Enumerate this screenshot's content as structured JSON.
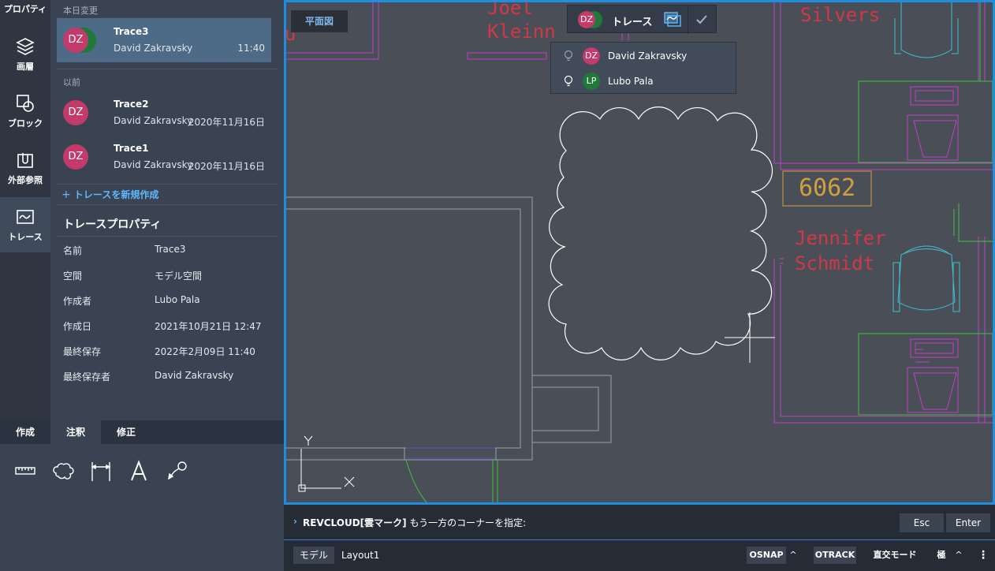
{
  "rail": {
    "title": "プロパティ",
    "items": [
      {
        "label": "画層",
        "icon": "layers-icon"
      },
      {
        "label": "ブロック",
        "icon": "block-icon"
      },
      {
        "label": "外部参照",
        "icon": "xref-icon"
      },
      {
        "label": "トレース",
        "icon": "trace-icon"
      }
    ]
  },
  "traces": {
    "today_header": "本日変更",
    "earlier_header": "以前",
    "items": [
      {
        "name": "Trace3",
        "author": "David Zakravsky",
        "date": "11:40",
        "avatar": "DZ"
      },
      {
        "name": "Trace2",
        "author": "David Zakravsky",
        "date": "2020年11月16日",
        "avatar": "DZ"
      },
      {
        "name": "Trace1",
        "author": "David Zakravsky",
        "date": "2020年11月16日",
        "avatar": "DZ"
      }
    ],
    "new_trace": "トレースを新規作成"
  },
  "properties": {
    "title": "トレースプロパティ",
    "rows": [
      {
        "key": "名前",
        "value": "Trace3"
      },
      {
        "key": "空間",
        "value": "モデル空間"
      },
      {
        "key": "作成者",
        "value": "Lubo Pala"
      },
      {
        "key": "作成日",
        "value": "2021年10月21日 12:47"
      },
      {
        "key": "最終保存",
        "value": "2022年2月09日 11:40"
      },
      {
        "key": "最終保存者",
        "value": "David Zakravsky"
      }
    ]
  },
  "tool_tabs": [
    "作成",
    "注釈",
    "修正"
  ],
  "tools": [
    "ruler-icon",
    "revcloud-icon",
    "dimension-icon",
    "text-icon",
    "leader-icon"
  ],
  "canvas": {
    "view_label": "平面図",
    "trace_bar": {
      "label": "トレース",
      "avatar": "DZ"
    },
    "collaborators": [
      {
        "initials": "DZ",
        "name": "David Zakravsky"
      },
      {
        "initials": "LP",
        "name": "Lubo Pala"
      }
    ],
    "drawing_text": {
      "joel": [
        "Joel",
        "Kleinn"
      ],
      "silvers": "Silvers",
      "room": "6062",
      "jennifer": [
        "Jennifer",
        "Schmidt"
      ],
      "partial": "u"
    },
    "ucs": {
      "y": "Y",
      "x": "X"
    }
  },
  "command": {
    "name": "REVCLOUD[雲マーク]",
    "prompt": "もう一方のコーナーを指定:",
    "esc": "Esc",
    "enter": "Enter"
  },
  "status": {
    "tabs": [
      "モデル",
      "Layout1"
    ],
    "osnap": "OSNAP",
    "otrack": "OTRACK",
    "ortho": "直交モード",
    "polar": "極"
  },
  "colors": {
    "accent": "#1f8ee0",
    "avatar_dz": "#c43a6a",
    "avatar_lp": "#1f7a3a",
    "magenta_lines": "#c040c8",
    "green_lines": "#40c040",
    "cyan_lines": "#40c0d0",
    "red_text": "#d03848",
    "orange_text": "#d0a040"
  }
}
